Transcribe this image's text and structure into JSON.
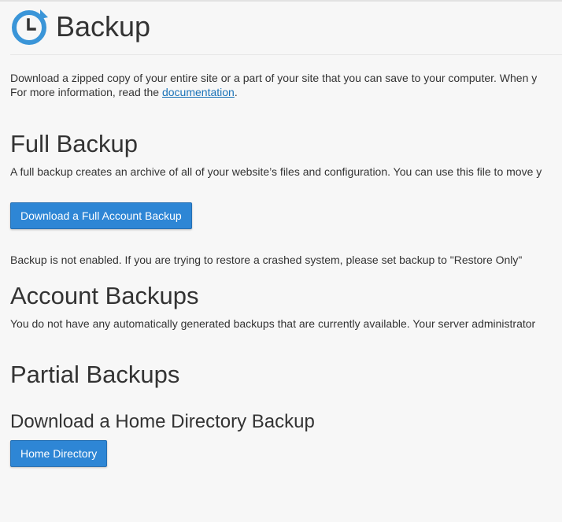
{
  "header": {
    "title": "Backup",
    "logo_icon": "backup-clock-icon",
    "accent_color": "#3a95d8"
  },
  "intro": {
    "line1": "Download a zipped copy of your entire site or a part of your site that you can save to your computer. When y",
    "line2_prefix": "For more information, read the ",
    "documentation_link": "documentation",
    "line2_suffix": "."
  },
  "full_backup": {
    "heading": "Full Backup",
    "description": "A full backup creates an archive of all of your website’s files and configuration. You can use this file to move y",
    "button_label": "Download a Full Account Backup",
    "status_text": "Backup is not enabled. If you are trying to restore a crashed system, please set backup to \"Restore Only\""
  },
  "account_backups": {
    "heading": "Account Backups",
    "description": "You do not have any automatically generated backups that are currently available. Your server administrator"
  },
  "partial_backups": {
    "heading": "Partial Backups",
    "home_directory": {
      "heading": "Download a Home Directory Backup",
      "button_label": "Home Directory"
    }
  },
  "colors": {
    "button_bg": "#2e86d5",
    "link": "#1a73b8",
    "text": "#333333",
    "page_bg": "#f7f7f7"
  }
}
